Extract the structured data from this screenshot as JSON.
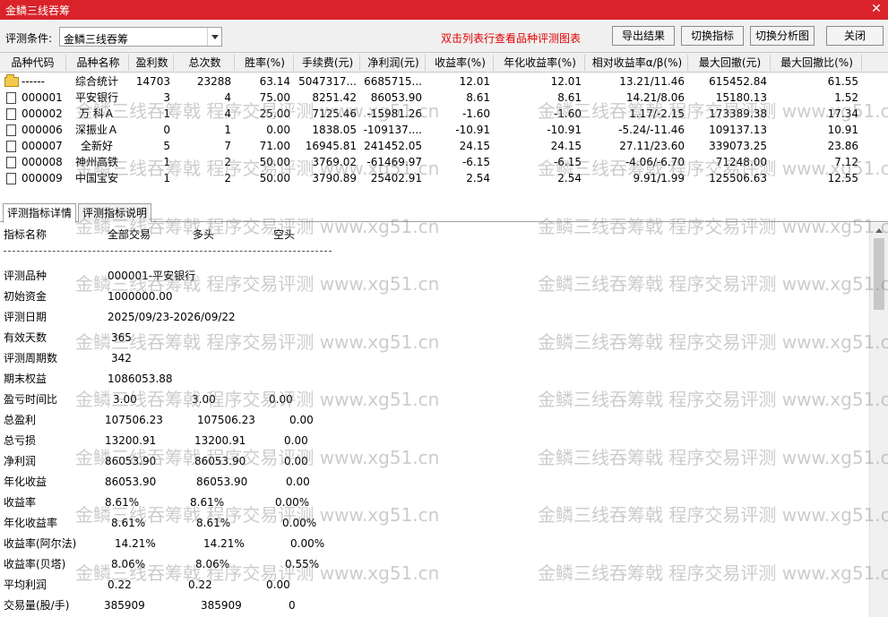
{
  "window": {
    "title": "金鳞三线吞筹"
  },
  "toolbar": {
    "condition_label": "评测条件:",
    "condition_value": "金鳞三线吞筹",
    "hint": "双击列表行查看品种评测图表",
    "export_label": "导出结果",
    "switch_indicator_label": "切换指标",
    "switch_chart_label": "切换分析图",
    "close_label": "关闭"
  },
  "grid": {
    "columns": [
      "品种代码",
      "品种名称",
      "盈利数",
      "总次数",
      "胜率(%)",
      "手续费(元)",
      "净利润(元)",
      "收益率(%)",
      "年化收益率(%)",
      "相对收益率α/β(%)",
      "最大回撤(元)",
      "最大回撤比(%)"
    ],
    "rows": [
      [
        "------",
        "综合统计",
        "14703",
        "23288",
        "63.14",
        "5047317...",
        "6685715...",
        "12.01",
        "12.01",
        "13.21/11.46",
        "615452.84",
        "61.55"
      ],
      [
        "000001",
        "平安银行",
        "3",
        "4",
        "75.00",
        "8251.42",
        "86053.90",
        "8.61",
        "8.61",
        "14.21/8.06",
        "15180.13",
        "1.52"
      ],
      [
        "000002",
        "万 科Ａ",
        "1",
        "4",
        "25.00",
        "7125.46",
        "-15981.26",
        "-1.60",
        "-1.60",
        "1.17/-2.15",
        "173389.38",
        "17.34"
      ],
      [
        "000006",
        "深振业Ａ",
        "0",
        "1",
        "0.00",
        "1838.05",
        "-109137....",
        "-10.91",
        "-10.91",
        "-5.24/-11.46",
        "109137.13",
        "10.91"
      ],
      [
        "000007",
        "全新好",
        "5",
        "7",
        "71.00",
        "16945.81",
        "241452.05",
        "24.15",
        "24.15",
        "27.11/23.60",
        "339073.25",
        "23.86"
      ],
      [
        "000008",
        "神州高铁",
        "1",
        "2",
        "50.00",
        "3769.02",
        "-61469.97",
        "-6.15",
        "-6.15",
        "-4.06/-6.70",
        "71248.00",
        "7.12"
      ],
      [
        "000009",
        "中国宝安",
        "1",
        "2",
        "50.00",
        "3790.89",
        "25402.91",
        "2.54",
        "2.54",
        "9.91/1.99",
        "125506.63",
        "12.55"
      ]
    ]
  },
  "tabs": [
    "评测指标详情",
    "评测指标说明"
  ],
  "detail": {
    "header": [
      "指标名称",
      "全部交易",
      "多头",
      "空头"
    ],
    "info": [
      [
        "评测品种",
        "000001-平安银行"
      ],
      [
        "初始资金",
        "1000000.00"
      ],
      [
        "评测日期",
        "2025/09/23-2026/09/22"
      ],
      [
        "有效天数",
        "365"
      ],
      [
        "评测周期数",
        "342"
      ],
      [
        "期末权益",
        "1086053.88"
      ]
    ],
    "metrics": [
      [
        "盈亏时间比",
        "3.00",
        "3.00",
        "0.00"
      ],
      [
        "总盈利",
        "107506.23",
        "107506.23",
        "0.00"
      ],
      [
        "总亏损",
        "13200.91",
        "13200.91",
        "0.00"
      ],
      [
        "净利润",
        "86053.90",
        "86053.90",
        "0.00"
      ],
      [
        "年化收益",
        "86053.90",
        "86053.90",
        "0.00"
      ],
      [
        "收益率",
        "8.61%",
        "8.61%",
        "0.00%"
      ],
      [
        "年化收益率",
        "8.61%",
        "8.61%",
        "0.00%"
      ],
      [
        "收益率(阿尔法)",
        "14.21%",
        "14.21%",
        "0.00%"
      ],
      [
        "收益率(贝塔)",
        "8.06%",
        "8.06%",
        "0.55%"
      ],
      [
        "平均利润",
        "0.22",
        "0.22",
        "0.00"
      ],
      [
        "交易量(股/手)",
        "385909",
        "385909",
        "0"
      ]
    ]
  },
  "watermark": {
    "text": "金鳞三线吞筹戟 程序交易评测 www.xg51.cn"
  }
}
